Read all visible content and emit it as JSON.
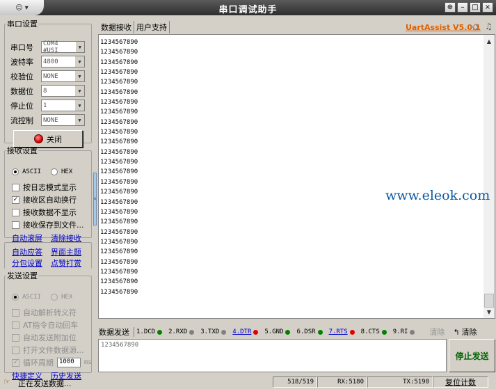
{
  "window": {
    "title": "串口调试助手",
    "menu_btn": "☺ ▾",
    "pin": "⊕",
    "minimize": "–",
    "maximize": "□",
    "close": "×"
  },
  "port_settings": {
    "legend": "串口设置",
    "port": {
      "label": "串口号",
      "value": "COM4 #USI"
    },
    "baud": {
      "label": "波特率",
      "value": "4800"
    },
    "parity": {
      "label": "校验位",
      "value": "NONE"
    },
    "databits": {
      "label": "数据位",
      "value": "8"
    },
    "stopbits": {
      "label": "停止位",
      "value": "1"
    },
    "flow": {
      "label": "流控制",
      "value": "NONE"
    },
    "close_btn": "关闭"
  },
  "recv_settings": {
    "legend": "接收设置",
    "ascii": "ASCII",
    "hex": "HEX",
    "log_mode": "按日志模式显示",
    "auto_newline": "接收区自动换行",
    "hide_data": "接收数据不显示",
    "save_file": "接收保存到文件...",
    "auto_scroll": "自动滚屏",
    "clear_recv": "清除接收"
  },
  "misc_links": {
    "auto_reply": "自动应答",
    "theme": "界面主题",
    "split_send": "分包设置",
    "timestamp": "点赞打赏"
  },
  "send_settings": {
    "legend": "发送设置",
    "ascii": "ASCII",
    "hex": "HEX",
    "parse_escape": "自动解析转义符",
    "at_return": "AT指令自动回车",
    "append_check": "自动发送附加位",
    "open_file": "打开文件数据源...",
    "loop_period": "循环周期",
    "period_value": "1000",
    "period_unit": "ms",
    "shortcuts": "快捷定义",
    "history": "历史发送"
  },
  "tabs": {
    "recv": "数据接收",
    "user": "用户支持"
  },
  "version": "UartAssist V5.0.1",
  "received_lines": [
    "1234567890",
    "1234567890",
    "1234567890",
    "1234567890",
    "1234567890",
    "1234567890",
    "1234567890",
    "1234567890",
    "1234567890",
    "1234567890",
    "1234567890",
    "1234567890",
    "1234567890",
    "1234567890",
    "1234567890",
    "1234567890",
    "1234567890",
    "1234567890",
    "1234567890",
    "1234567890",
    "1234567890",
    "1234567890",
    "1234567890",
    "1234567890",
    "1234567890",
    "1234567890"
  ],
  "watermark": "www.eleok.com",
  "send_bar": {
    "label": "数据发送",
    "signals": [
      {
        "text": "1.DCD",
        "color": "#008000",
        "link": false
      },
      {
        "text": "2.RXD",
        "color": "#808080",
        "link": false
      },
      {
        "text": "3.TXD",
        "color": "#808080",
        "link": false
      },
      {
        "text": "4.DTR",
        "color": "#e00000",
        "link": true
      },
      {
        "text": "5.GND",
        "color": "#008000",
        "link": false
      },
      {
        "text": "6.DSR",
        "color": "#008000",
        "link": false
      },
      {
        "text": "7.RTS",
        "color": "#e00000",
        "link": true
      },
      {
        "text": "8.CTS",
        "color": "#008000",
        "link": false
      },
      {
        "text": "9.RI",
        "color": "#808080",
        "link": false
      }
    ],
    "clear": "清除",
    "clear2": "清除"
  },
  "send_text": "1234567890",
  "stop_send": "停止发送",
  "status": {
    "message": "正在发送数据...",
    "progress": "518/519",
    "rx": "RX:5180",
    "tx": "TX:5190",
    "reset": "复位计数"
  }
}
